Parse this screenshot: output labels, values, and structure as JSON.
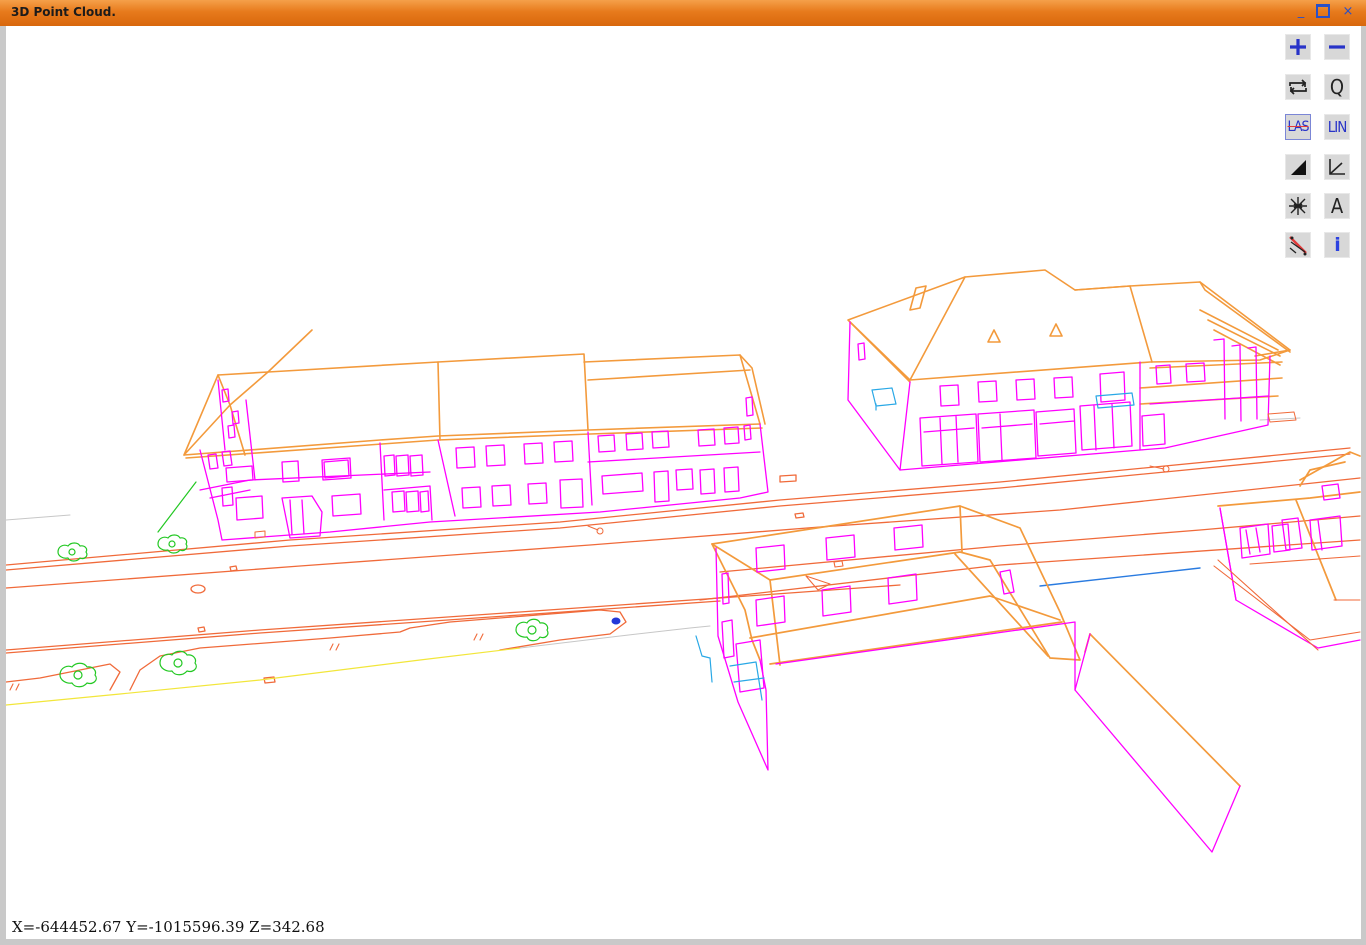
{
  "window": {
    "title": "3D Point Cloud.",
    "controls": {
      "minimize": "_",
      "close": "×"
    }
  },
  "status": {
    "coordinates": "X=-644452.67 Y=-1015596.39 Z=342.68"
  },
  "toolbar": {
    "buttons": [
      {
        "name": "zoom-in",
        "icon": "plus-icon"
      },
      {
        "name": "zoom-out",
        "icon": "minus-icon"
      },
      {
        "name": "rotate",
        "icon": "rotate-icon"
      },
      {
        "name": "query",
        "icon": "query-icon",
        "label": "Q"
      },
      {
        "name": "las",
        "icon": "las-icon",
        "label": "LAS",
        "active": true
      },
      {
        "name": "lin",
        "icon": "lin-icon",
        "label": "LIN"
      },
      {
        "name": "shading",
        "icon": "triangle-icon"
      },
      {
        "name": "axes",
        "icon": "angle-icon"
      },
      {
        "name": "points",
        "icon": "snap-icon"
      },
      {
        "name": "text",
        "icon": "text-icon",
        "label": "A"
      },
      {
        "name": "delete-lines",
        "icon": "delete-lines-icon"
      },
      {
        "name": "info",
        "icon": "info-icon",
        "label": "i"
      }
    ]
  },
  "colors": {
    "title_bar": "#e77a1c",
    "roof_lines": "#f39a3c",
    "wall_lines": "#ff00ff",
    "road_lines": "#f06a3a",
    "vegetation": "#22c822",
    "accent_blue": "#2833c8",
    "cyan_detail": "#29a8e6"
  }
}
